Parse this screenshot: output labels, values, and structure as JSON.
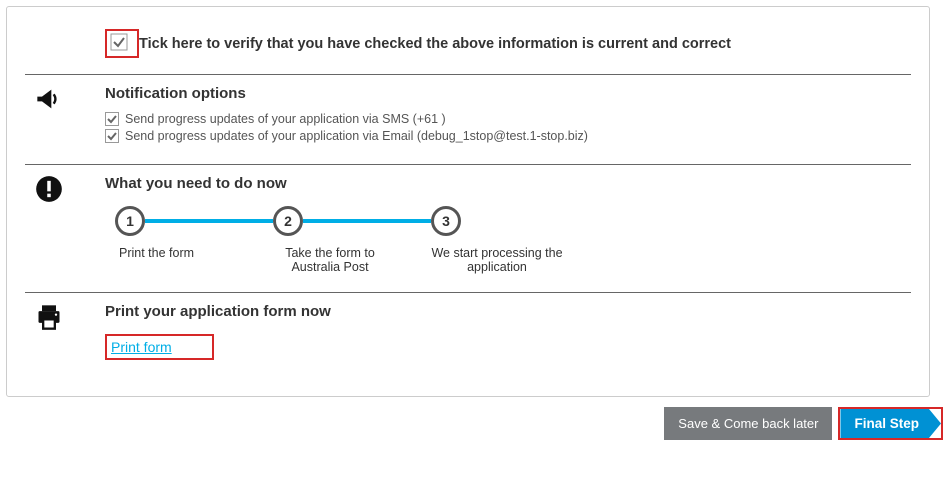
{
  "verify": {
    "label": "Tick here to verify that you have checked the above information is current and correct"
  },
  "notification": {
    "title": "Notification options",
    "sms_label": "Send progress updates of your application via SMS  (+61 )",
    "email_label": "Send progress updates of your application via Email  (debug_1stop@test.1-stop.biz)"
  },
  "todo": {
    "title": "What you need to do now",
    "steps": [
      {
        "num": "1",
        "label": "Print the form"
      },
      {
        "num": "2",
        "label": "Take the form to Australia Post"
      },
      {
        "num": "3",
        "label": "We start processing the application"
      }
    ]
  },
  "print": {
    "title": "Print your application form now",
    "link_label": "Print form"
  },
  "footer": {
    "save_label": "Save & Come back later",
    "final_label": "Final Step"
  }
}
